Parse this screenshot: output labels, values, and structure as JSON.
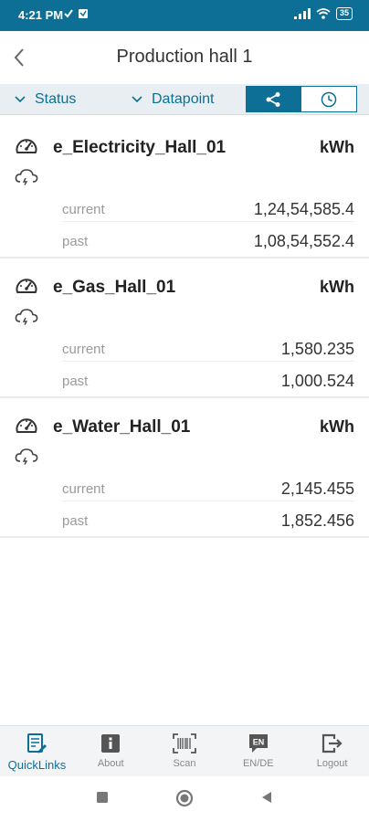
{
  "status_bar": {
    "time": "4:21 PM",
    "battery": "35"
  },
  "header": {
    "title": "Production hall 1"
  },
  "filters": {
    "status_label": "Status",
    "datapoint_label": "Datapoint"
  },
  "datapoints": [
    {
      "name": "e_Electricity_Hall_01",
      "unit": "kWh",
      "current_label": "current",
      "current_value": "1,24,54,585.4",
      "past_label": "past",
      "past_value": "1,08,54,552.4"
    },
    {
      "name": "e_Gas_Hall_01",
      "unit": "kWh",
      "current_label": "current",
      "current_value": "1,580.235",
      "past_label": "past",
      "past_value": "1,000.524"
    },
    {
      "name": "e_Water_Hall_01",
      "unit": "kWh",
      "current_label": "current",
      "current_value": "2,145.455",
      "past_label": "past",
      "past_value": "1,852.456"
    }
  ],
  "bottom_nav": [
    {
      "label": "QuickLinks",
      "icon": "quicklinks-icon",
      "active": true
    },
    {
      "label": "About",
      "icon": "info-icon",
      "active": false
    },
    {
      "label": "Scan",
      "icon": "barcode-icon",
      "active": false
    },
    {
      "label": "EN/DE",
      "icon": "language-icon",
      "active": false
    },
    {
      "label": "Logout",
      "icon": "logout-icon",
      "active": false
    }
  ],
  "colors": {
    "primary": "#0d6f95",
    "filter_bg": "#e9eef2",
    "muted_text": "#9a9a9a"
  }
}
